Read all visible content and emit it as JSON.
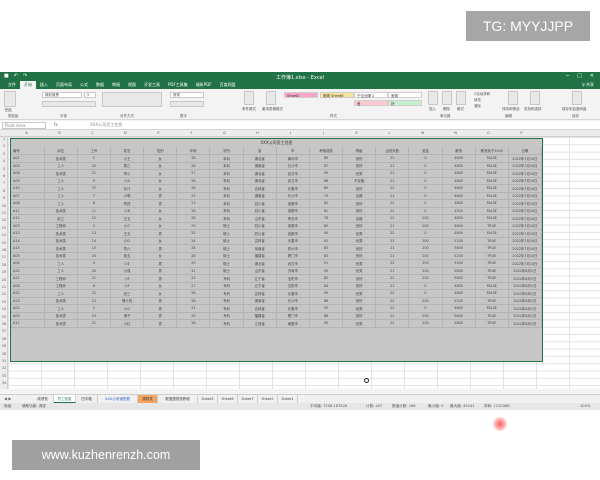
{
  "watermarks": {
    "top": "TG: MYYJJPP",
    "bottom": "www.kuzhenrenzh.com"
  },
  "titlebar": {
    "title": "工作簿1.xlsx - Excel",
    "undo": "↶",
    "redo": "↷",
    "save": "■",
    "minimize": "─",
    "maximize": "□",
    "close": "✕"
  },
  "menu": [
    "文件",
    "开始",
    "插入",
    "页面布局",
    "公式",
    "数据",
    "审阅",
    "视图",
    "开发工具",
    "PDF工具集",
    "福昕PDF",
    "百度网盘"
  ],
  "menu_share": "♀ 共享",
  "ribbon": {
    "paste": "粘贴",
    "font_name": "微软雅黑",
    "font_size": "9",
    "number_format": "常规",
    "conditional": "条件格式",
    "table_format": "套用表格格式",
    "style_sheet1": "Sheet1",
    "style_sheet6": "常规 Sheet6",
    "style_1000sep": "千位分隔 2",
    "style_normal": "常规",
    "style_bad": "差",
    "style_good": "好",
    "insert": "插入",
    "delete": "删除",
    "format": "格式",
    "autosum": "Σ自动求和",
    "fill": "填充",
    "clear": "清除",
    "sort": "排序和筛选",
    "find": "查找和选择",
    "save_baidu": "保存到百度网盘",
    "groups": [
      "剪贴板",
      "字体",
      "对齐方式",
      "数字",
      "样式",
      "单元格",
      "编辑",
      "保存"
    ]
  },
  "formula_bar": {
    "namebox": "Pivot Area",
    "fx": "fx",
    "formula": "XXX公司员工信息"
  },
  "columns": [
    "A",
    "B",
    "C",
    "D",
    "E",
    "F",
    "G",
    "H",
    "I",
    "J",
    "K",
    "L",
    "M",
    "N",
    "O",
    "P"
  ],
  "rows": [
    "1",
    "2",
    "3",
    "4",
    "5",
    "6",
    "7",
    "8",
    "9",
    "10",
    "11",
    "12",
    "13",
    "14",
    "15",
    "16",
    "17",
    "18",
    "19",
    "20",
    "21",
    "22",
    "23",
    "24",
    "25",
    "26",
    "27",
    "28",
    "29",
    "30",
    "31",
    "32",
    "33",
    "34"
  ],
  "table": {
    "title": "XXX公司员工信息",
    "header": [
      "编号",
      "岗位",
      "工号",
      "姓名",
      "性别",
      "年龄",
      "学历",
      "省",
      "市",
      "考核成绩",
      "等级",
      "出勤天数",
      "奖金",
      "薪资",
      "薪资高于5000",
      "日期"
    ],
    "rows": [
      [
        "A01",
        "技术类",
        "1",
        "小王",
        "女",
        "28",
        "本科",
        "湖北省",
        "黄冈市",
        "89",
        "良好",
        "22",
        "0",
        "4600",
        "FALSE",
        "2022年7月10日"
      ],
      [
        "A03",
        "工人",
        "25",
        "周三",
        "女",
        "26",
        "本科",
        "湖南省",
        "长沙市",
        "87",
        "良好",
        "21",
        "0",
        "4800",
        "FALSE",
        "2022年7月10日"
      ],
      [
        "A06",
        "技术类",
        "21",
        "李小",
        "女",
        "27",
        "本科",
        "湖北省",
        "武汉市",
        "90",
        "优秀",
        "21",
        "0",
        "4800",
        "FALSE",
        "2022年7月10日"
      ],
      [
        "A09",
        "工人",
        "9",
        "小A",
        "女",
        "26",
        "本科",
        "湖北省",
        "武汉市",
        "68",
        "不及格",
        "21",
        "0",
        "4800",
        "FALSE",
        "2022年7月10日"
      ],
      [
        "A10",
        "工人",
        "37",
        "孙乃",
        "女",
        "26",
        "本科",
        "吉林省",
        "长春市",
        "80",
        "良好",
        "22",
        "0",
        "4600",
        "FALSE",
        "2022年7月10日"
      ],
      [
        "A07",
        "工人",
        "7",
        "小明",
        "男",
        "22",
        "本科",
        "湖南省",
        "长沙市",
        "79",
        "及格",
        "21",
        "0",
        "4600",
        "FALSE",
        "2022年7月10日"
      ],
      [
        "A08",
        "工人",
        "8",
        "李四",
        "男",
        "23",
        "本科",
        "四川省",
        "成都市",
        "82",
        "良好",
        "22",
        "0",
        "4800",
        "FALSE",
        "2022年7月10日"
      ],
      [
        "A11",
        "技术类",
        "11",
        "小B",
        "女",
        "26",
        "本科",
        "四川省",
        "成都市",
        "81",
        "良好",
        "22",
        "0",
        "4500",
        "FALSE",
        "2022年7月10日"
      ],
      [
        "A12",
        "前工",
        "12",
        "王五",
        "女",
        "28",
        "本科",
        "山东省",
        "青岛市",
        "78",
        "及格",
        "22",
        "200",
        "4800",
        "FALSE",
        "2022年7月10日"
      ],
      [
        "A03",
        "工程师",
        "3",
        "小C",
        "女",
        "29",
        "硕士",
        "四川省",
        "成都市",
        "80",
        "良好",
        "21",
        "200",
        "5600",
        "TRUE",
        "2022年7月10日"
      ],
      [
        "A13",
        "技术类",
        "13",
        "王五",
        "男",
        "25",
        "硕士",
        "四川省",
        "成都市",
        "90",
        "优秀",
        "22",
        "0",
        "4800",
        "FALSE",
        "2022年7月10日"
      ],
      [
        "A14",
        "技术类",
        "14",
        "小D",
        "女",
        "24",
        "硕士",
        "吉林省",
        "长春市",
        "92",
        "优秀",
        "22",
        "200",
        "5200",
        "TRUE",
        "2022年7月10日"
      ],
      [
        "A15",
        "技术类",
        "15",
        "李六",
        "男",
        "28",
        "硕士",
        "河南省",
        "郑州市",
        "85",
        "良好",
        "21",
        "200",
        "5600",
        "TRUE",
        "2022年7月10日"
      ],
      [
        "A05",
        "技术类",
        "20",
        "吴五",
        "女",
        "28",
        "硕士",
        "福建省",
        "厦门市",
        "83",
        "良好",
        "21",
        "200",
        "5200",
        "TRUE",
        "2022年7月10日"
      ],
      [
        "A04",
        "工人",
        "4",
        "小E",
        "男",
        "29",
        "硕士",
        "湖北省",
        "武汉市",
        "91",
        "优秀",
        "22",
        "200",
        "5300",
        "TRUE",
        "2022年7月10日"
      ],
      [
        "A20",
        "工人",
        "20",
        "小强",
        "男",
        "31",
        "硕士",
        "山东省",
        "济南市",
        "90",
        "优秀",
        "21",
        "200",
        "5800",
        "TRUE",
        "2022年8月1日"
      ],
      [
        "A21",
        "工程师",
        "21",
        "小F",
        "男",
        "23",
        "专科",
        "辽宁省",
        "沈阳市",
        "82",
        "良好",
        "22",
        "200",
        "5600",
        "TRUE",
        "2022年8月1日"
      ],
      [
        "A06",
        "工程师",
        "6",
        "小F",
        "女",
        "27",
        "专科",
        "辽宁省",
        "沈阳市",
        "84",
        "良好",
        "21",
        "0",
        "4800",
        "FALSE",
        "2022年8月1日"
      ],
      [
        "A22",
        "工人",
        "22",
        "张三",
        "女",
        "26",
        "专科",
        "吉林省",
        "长春市",
        "90",
        "优秀",
        "22",
        "0",
        "4800",
        "FALSE",
        "2022年8月1日"
      ],
      [
        "A23",
        "技术类",
        "23",
        "槐十四",
        "男",
        "28",
        "专科",
        "湖南省",
        "长沙市",
        "88",
        "良好",
        "22",
        "200",
        "5200",
        "TRUE",
        "2022年8月1日"
      ],
      [
        "A02",
        "工人",
        "2",
        "小G",
        "男",
        "21",
        "专科",
        "吉林省",
        "长春市",
        "92",
        "优秀",
        "22",
        "0",
        "4600",
        "FALSE",
        "2022年8月1日"
      ],
      [
        "A03",
        "技术类",
        "23",
        "海子",
        "男",
        "25",
        "专科",
        "福建省",
        "厦门市",
        "88",
        "良好",
        "22",
        "200",
        "5600",
        "TRUE",
        "2022年8月1日"
      ],
      [
        "A11",
        "技术类",
        "21",
        "小红",
        "男",
        "26",
        "专科",
        "江西省",
        "南昌市",
        "90",
        "优秀",
        "22",
        "200",
        "5800",
        "TRUE",
        "2022年8月1日"
      ]
    ]
  },
  "sheet_tabs": [
    "成绩表",
    "员工信息",
    "田字格",
    "XXX公司销售额",
    "课程表",
    "数据透视表教程",
    "Sheet5",
    "Sheet6",
    "Sheet7",
    "Sheet2",
    "Sheet1"
  ],
  "status": {
    "ready": "就绪",
    "accessibility": "辅助功能: 调查",
    "avg": "平均值: 7258.187826",
    "count": "计数: 407",
    "numcount": "数值计数: 166",
    "min": "最小值: 0",
    "max": "最大值: 45141",
    "sum": "求和: 1210388",
    "zoom": "100%"
  }
}
